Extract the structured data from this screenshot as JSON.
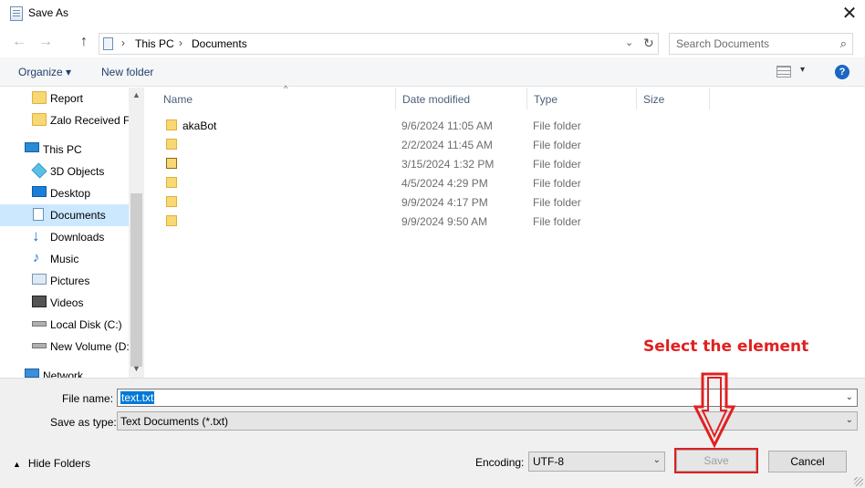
{
  "window": {
    "title": "Save As",
    "close_glyph": "✕"
  },
  "nav_buttons": {
    "back": "←",
    "forward": "→",
    "up": "↑"
  },
  "address": {
    "icon": "documents-icon",
    "breadcrumbs": [
      "This PC",
      "Documents"
    ],
    "separator": "›",
    "dropdown_glyph": "⌄",
    "refresh_glyph": "↻"
  },
  "search": {
    "placeholder": "Search Documents",
    "icon_glyph": "⌕"
  },
  "toolbar": {
    "organize": "Organize ▾",
    "new_folder": "New folder",
    "help": "?",
    "view_dropdown": "▾"
  },
  "sidebar": {
    "items": [
      {
        "label": "Report",
        "icon": "folder-icon"
      },
      {
        "label": "Zalo Received Fi",
        "icon": "folder-icon"
      },
      {
        "label": "This PC",
        "icon": "computer-icon"
      },
      {
        "label": "3D Objects",
        "icon": "3d-objects-icon"
      },
      {
        "label": "Desktop",
        "icon": "desktop-icon"
      },
      {
        "label": "Documents",
        "icon": "documents-icon",
        "selected": true
      },
      {
        "label": "Downloads",
        "icon": "downloads-icon"
      },
      {
        "label": "Music",
        "icon": "music-icon"
      },
      {
        "label": "Pictures",
        "icon": "pictures-icon"
      },
      {
        "label": "Videos",
        "icon": "videos-icon"
      },
      {
        "label": "Local Disk (C:)",
        "icon": "drive-icon"
      },
      {
        "label": "New Volume (D:",
        "icon": "drive-icon"
      },
      {
        "label": "Network",
        "icon": "network-icon"
      }
    ],
    "scroll_up": "▲",
    "scroll_down": "▼"
  },
  "columns": {
    "name": "Name",
    "date": "Date modified",
    "type": "Type",
    "size": "Size",
    "sort_glyph": "^"
  },
  "files": [
    {
      "name": "akaBot",
      "date": "9/6/2024 11:05 AM",
      "type": "File folder"
    },
    {
      "name": "",
      "date": "2/2/2024 11:45 AM",
      "type": "File folder"
    },
    {
      "name": "",
      "date": "3/15/2024 1:32 PM",
      "type": "File folder"
    },
    {
      "name": "",
      "date": "4/5/2024 4:29 PM",
      "type": "File folder"
    },
    {
      "name": "",
      "date": "9/9/2024 4:17 PM",
      "type": "File folder"
    },
    {
      "name": "",
      "date": "9/9/2024 9:50 AM",
      "type": "File folder"
    }
  ],
  "form": {
    "file_name_label": "File name:",
    "file_name_value": "text.txt",
    "save_type_label": "Save as type:",
    "save_type_value": "Text Documents (*.txt)",
    "encoding_label": "Encoding:",
    "encoding_value": "UTF-8",
    "dropdown_glyph": "⌄"
  },
  "buttons": {
    "hide_folders": "Hide Folders",
    "hide_caret": "▲",
    "save": "Save",
    "cancel": "Cancel"
  },
  "annotation": {
    "text": "Select the element",
    "color": "#e02020"
  }
}
